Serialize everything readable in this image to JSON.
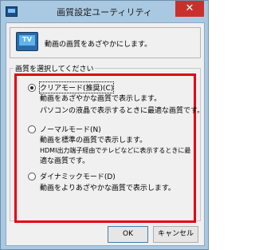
{
  "window": {
    "title": "画質設定ユーティリティ",
    "close_glyph": "✕"
  },
  "info": {
    "icon_label": "TV",
    "text": "動画の画質をあざやかにします。"
  },
  "group": {
    "legend": "画質を選択してください",
    "options": [
      {
        "label": "クリアモード(推奨)(C)",
        "selected": true,
        "desc": [
          "動画をあざやかな画質で表示します。",
          "パソコンの液晶で表示するときに最適な画質です。"
        ]
      },
      {
        "label": "ノーマルモード(N)",
        "selected": false,
        "desc": [
          "動画を標準の画質で表示します。",
          "HDMI出力端子経由でテレビなどに表示するときに最",
          "適な画質です。"
        ]
      },
      {
        "label": "ダイナミックモード(D)",
        "selected": false,
        "desc": [
          "動画をよりあざやかな画質で表示します。"
        ]
      }
    ]
  },
  "buttons": {
    "ok": "OK",
    "cancel": "キャンセル"
  }
}
